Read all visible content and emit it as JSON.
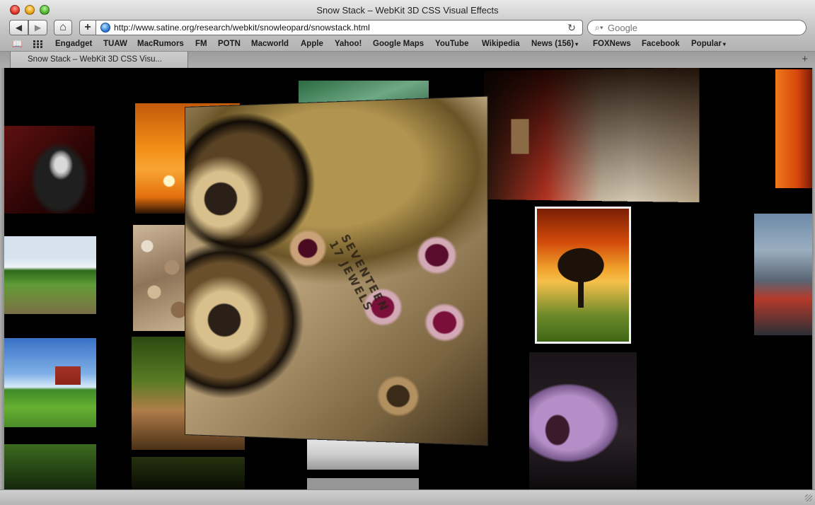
{
  "window": {
    "title": "Snow Stack – WebKit 3D CSS Visual Effects"
  },
  "toolbar": {
    "back_icon": "◀",
    "forward_icon": "▶",
    "home_icon": "⌂",
    "add_icon": "+",
    "url": "http://www.satine.org/research/webkit/snowleopard/snowstack.html",
    "reload_icon": "↻",
    "search_placeholder": "Google",
    "search_icon": "⌕▾"
  },
  "bookmarks": {
    "reading_icon": "📖",
    "items": [
      {
        "label": "Engadget"
      },
      {
        "label": "TUAW"
      },
      {
        "label": "MacRumors"
      },
      {
        "label": "FM"
      },
      {
        "label": "POTN"
      },
      {
        "label": "Macworld"
      },
      {
        "label": "Apple"
      },
      {
        "label": "Yahoo!"
      },
      {
        "label": "Google Maps"
      },
      {
        "label": "YouTube"
      },
      {
        "label": "Wikipedia"
      },
      {
        "label": "News (156)",
        "arrow": "▾"
      },
      {
        "label": "FOXNews"
      },
      {
        "label": "Facebook"
      },
      {
        "label": "Popular",
        "arrow": "▾"
      }
    ]
  },
  "tabs": {
    "active_label": "Snow Stack – WebKit 3D CSS Visu...",
    "new_tab_icon": "+"
  },
  "content": {
    "watch_engraving_line1": "SEVENTEEN",
    "watch_engraving_line2": "17 JEWELS"
  }
}
